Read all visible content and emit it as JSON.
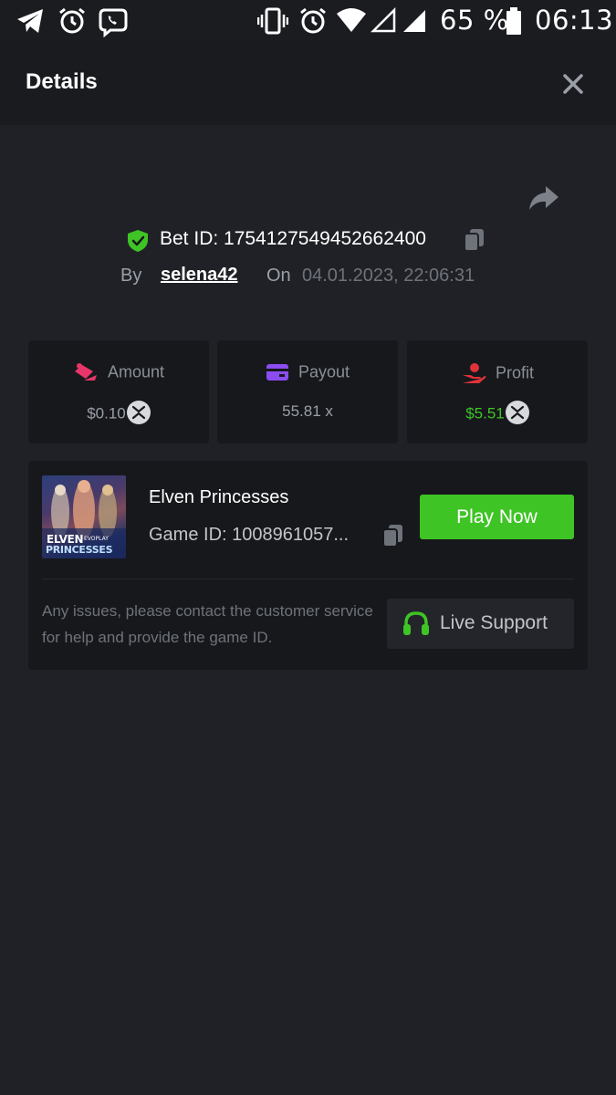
{
  "status_bar": {
    "battery_percent": "65 %",
    "time": "06:13",
    "left_icons": [
      "telegram-icon",
      "alarm-icon",
      "viber-icon"
    ],
    "right_icons": [
      "vibrate-icon",
      "alarm-icon",
      "wifi-icon",
      "signal-empty-icon",
      "signal-icon",
      "battery-icon"
    ]
  },
  "header": {
    "title": "Details",
    "close_icon": "close-icon"
  },
  "bet": {
    "bet_id_label": "Bet ID: 1754127549452662400",
    "by_label": "By",
    "username": "selena42",
    "on_label": "On",
    "datetime": "04.01.2023, 22:06:31"
  },
  "stats": {
    "amount": {
      "label": "Amount",
      "value": "$0.10",
      "icon": "amount-icon"
    },
    "payout": {
      "label": "Payout",
      "value": "55.81 x",
      "icon": "wallet-icon"
    },
    "profit": {
      "label": "Profit",
      "value": "$5.51",
      "icon": "hand-coin-icon"
    }
  },
  "game": {
    "name": "Elven Princesses",
    "game_id": "Game ID: 1008961057...",
    "play_label": "Play Now",
    "thumb_text_1": "ELVEN",
    "thumb_text_2": "PRINCESSES",
    "thumb_text_3": "EVOPLAY"
  },
  "support": {
    "help_text": "Any issues, please contact the customer service for help and provide the game ID.",
    "button_label": "Live Support"
  },
  "colors": {
    "background": "#202126",
    "card": "#17181c",
    "accent_green": "#3fc426",
    "amount_pink": "#e8366a",
    "payout_purple": "#8b4df0",
    "profit_red": "#e0323a"
  }
}
